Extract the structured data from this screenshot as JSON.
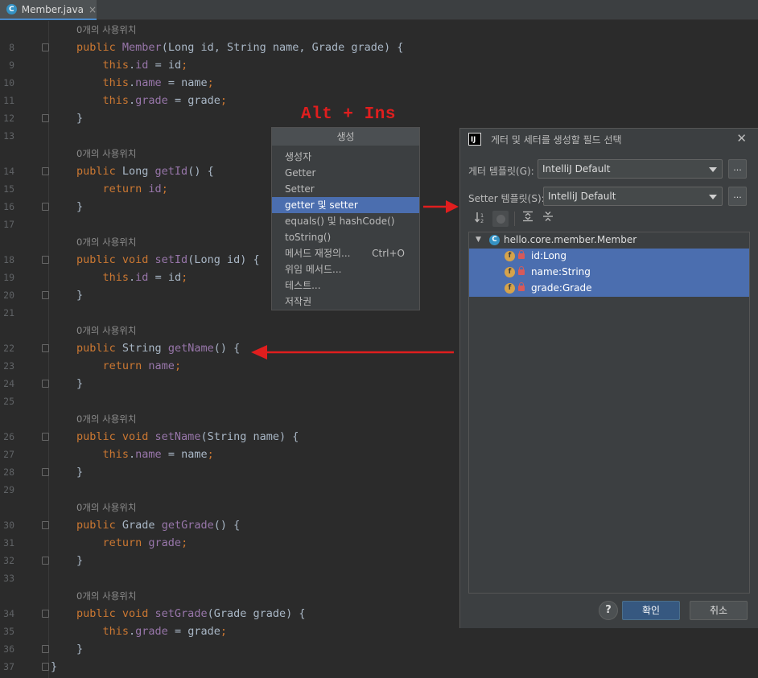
{
  "tab": {
    "icon": "C",
    "label": "Member.java",
    "close": "×"
  },
  "code": {
    "usage_hint": "0개의 사용위치",
    "lines": [
      {
        "num": "8",
        "tokens": [
          [
            "kw",
            "public "
          ],
          [
            "fd",
            "Member"
          ],
          [
            "pl",
            "(Long id, String name, Grade grade) {"
          ]
        ]
      },
      {
        "num": "9",
        "tokens": [
          [
            "pl",
            "    "
          ],
          [
            "kw",
            "this"
          ],
          [
            "pl",
            "."
          ],
          [
            "fd",
            "id"
          ],
          [
            "pl",
            " = id"
          ],
          [
            "kw",
            ";"
          ]
        ]
      },
      {
        "num": "10",
        "tokens": [
          [
            "pl",
            "    "
          ],
          [
            "kw",
            "this"
          ],
          [
            "pl",
            "."
          ],
          [
            "fd",
            "name"
          ],
          [
            "pl",
            " = name"
          ],
          [
            "kw",
            ";"
          ]
        ]
      },
      {
        "num": "11",
        "tokens": [
          [
            "pl",
            "    "
          ],
          [
            "kw",
            "this"
          ],
          [
            "pl",
            "."
          ],
          [
            "fd",
            "grade"
          ],
          [
            "pl",
            " = grade"
          ],
          [
            "kw",
            ";"
          ]
        ]
      },
      {
        "num": "12",
        "tokens": [
          [
            "pl",
            "}"
          ]
        ]
      },
      {
        "num": "13",
        "tokens": []
      },
      {
        "num": "14",
        "tokens": [
          [
            "kw",
            "public "
          ],
          [
            "pl",
            "Long "
          ],
          [
            "fd",
            "getId"
          ],
          [
            "pl",
            "() {"
          ]
        ]
      },
      {
        "num": "15",
        "tokens": [
          [
            "pl",
            "    "
          ],
          [
            "kw",
            "return "
          ],
          [
            "fd",
            "id"
          ],
          [
            "kw",
            ";"
          ]
        ]
      },
      {
        "num": "16",
        "tokens": [
          [
            "pl",
            "}"
          ]
        ]
      },
      {
        "num": "17",
        "tokens": []
      },
      {
        "num": "18",
        "tokens": [
          [
            "kw",
            "public void "
          ],
          [
            "fd",
            "setId"
          ],
          [
            "pl",
            "(Long id) {"
          ]
        ]
      },
      {
        "num": "19",
        "tokens": [
          [
            "pl",
            "    "
          ],
          [
            "kw",
            "this"
          ],
          [
            "pl",
            "."
          ],
          [
            "fd",
            "id"
          ],
          [
            "pl",
            " = id"
          ],
          [
            "kw",
            ";"
          ]
        ]
      },
      {
        "num": "20",
        "tokens": [
          [
            "pl",
            "}"
          ]
        ]
      },
      {
        "num": "21",
        "tokens": []
      },
      {
        "num": "22",
        "tokens": [
          [
            "kw",
            "public "
          ],
          [
            "pl",
            "String "
          ],
          [
            "fd",
            "getName"
          ],
          [
            "pl",
            "() {"
          ]
        ]
      },
      {
        "num": "23",
        "tokens": [
          [
            "pl",
            "    "
          ],
          [
            "kw",
            "return "
          ],
          [
            "fd",
            "name"
          ],
          [
            "kw",
            ";"
          ]
        ]
      },
      {
        "num": "24",
        "tokens": [
          [
            "pl",
            "}"
          ]
        ]
      },
      {
        "num": "25",
        "tokens": []
      },
      {
        "num": "26",
        "tokens": [
          [
            "kw",
            "public void "
          ],
          [
            "fd",
            "setName"
          ],
          [
            "pl",
            "(String name) {"
          ]
        ]
      },
      {
        "num": "27",
        "tokens": [
          [
            "pl",
            "    "
          ],
          [
            "kw",
            "this"
          ],
          [
            "pl",
            "."
          ],
          [
            "fd",
            "name"
          ],
          [
            "pl",
            " = name"
          ],
          [
            "kw",
            ";"
          ]
        ]
      },
      {
        "num": "28",
        "tokens": [
          [
            "pl",
            "}"
          ]
        ]
      },
      {
        "num": "29",
        "tokens": []
      },
      {
        "num": "30",
        "tokens": [
          [
            "kw",
            "public "
          ],
          [
            "pl",
            "Grade "
          ],
          [
            "fd",
            "getGrade"
          ],
          [
            "pl",
            "() {"
          ]
        ]
      },
      {
        "num": "31",
        "tokens": [
          [
            "pl",
            "    "
          ],
          [
            "kw",
            "return "
          ],
          [
            "fd",
            "grade"
          ],
          [
            "kw",
            ";"
          ]
        ]
      },
      {
        "num": "32",
        "tokens": [
          [
            "pl",
            "}"
          ]
        ]
      },
      {
        "num": "33",
        "tokens": []
      },
      {
        "num": "34",
        "tokens": [
          [
            "kw",
            "public void "
          ],
          [
            "fd",
            "setGrade"
          ],
          [
            "pl",
            "(Grade grade) {"
          ]
        ]
      },
      {
        "num": "35",
        "tokens": [
          [
            "pl",
            "    "
          ],
          [
            "kw",
            "this"
          ],
          [
            "pl",
            "."
          ],
          [
            "fd",
            "grade"
          ],
          [
            "pl",
            " = grade"
          ],
          [
            "kw",
            ";"
          ]
        ]
      },
      {
        "num": "36",
        "tokens": [
          [
            "pl",
            "}"
          ]
        ]
      },
      {
        "num": "37",
        "tokens": [
          [
            "pl",
            "}"
          ]
        ]
      }
    ]
  },
  "annotation": {
    "shortcut_label": "Alt + Ins"
  },
  "generate_popup": {
    "title": "생성",
    "items": [
      {
        "label": "생성자",
        "shortcut": ""
      },
      {
        "label": "Getter",
        "shortcut": ""
      },
      {
        "label": "Setter",
        "shortcut": ""
      },
      {
        "label": "getter 및 setter",
        "shortcut": "",
        "selected": true
      },
      {
        "label": "equals() 및 hashCode()",
        "shortcut": ""
      },
      {
        "label": "toString()",
        "shortcut": ""
      },
      {
        "label": "메서드 재정의...",
        "shortcut": "Ctrl+O"
      },
      {
        "label": "위임 메서드...",
        "shortcut": ""
      },
      {
        "label": "테스트...",
        "shortcut": ""
      },
      {
        "label": "저작권",
        "shortcut": ""
      }
    ]
  },
  "dialog": {
    "app_icon": "IJ",
    "title": "게터 및 세터를 생성할 필드 선택",
    "close": "✕",
    "getter_template_label": "게터 템플릿(G):",
    "getter_template_value": "IntelliJ Default",
    "setter_template_label": "Setter 템플릿(S):",
    "setter_template_value": "IntelliJ Default",
    "dots": "...",
    "class_icon": "C",
    "class_name": "hello.core.member.Member",
    "field_icon": "f",
    "fields": [
      "id:Long",
      "name:String",
      "grade:Grade"
    ],
    "help": "?",
    "ok": "확인",
    "cancel": "취소"
  },
  "colors": {
    "accent_selection": "#4b6eaf",
    "annotation_red": "#e01e1e",
    "keyword": "#cc7832",
    "field": "#9876aa"
  }
}
